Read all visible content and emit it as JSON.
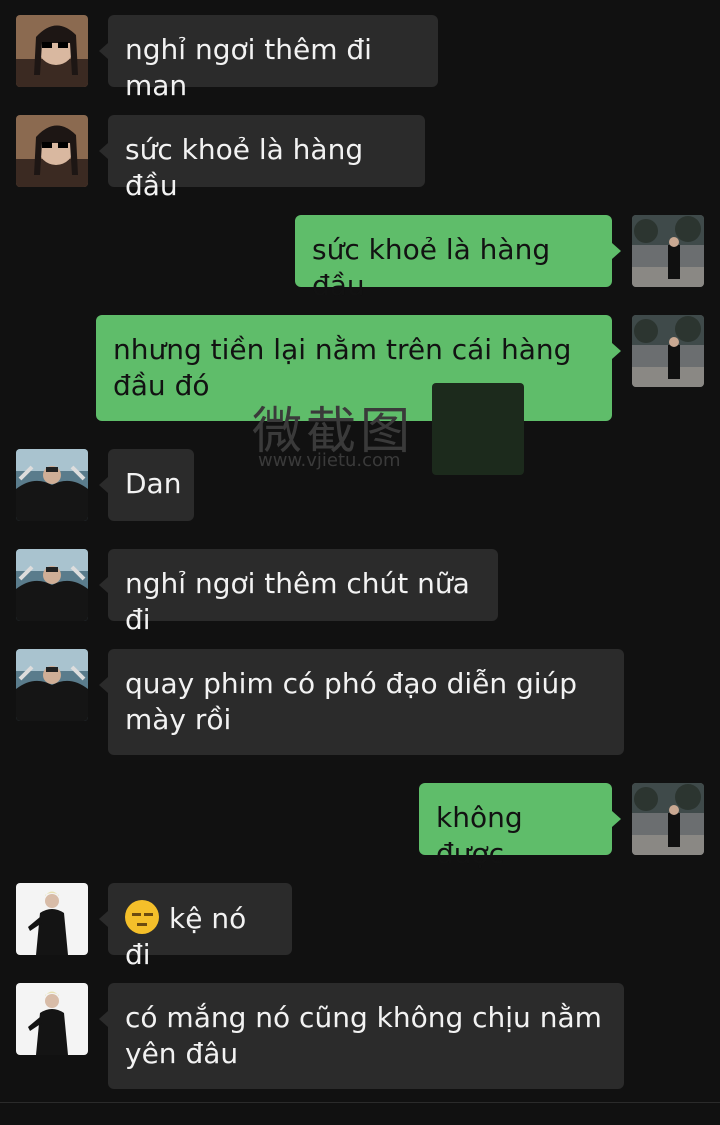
{
  "messages": [
    {
      "side": "in",
      "avatar": "avatar-sunglasses-icon",
      "text": "nghỉ ngơi thêm đi man"
    },
    {
      "side": "in",
      "avatar": "avatar-sunglasses-icon",
      "text": "sức khoẻ là hàng đầu"
    },
    {
      "side": "out",
      "avatar": "avatar-street-icon",
      "text": "sức khoẻ là hàng đầu"
    },
    {
      "side": "out",
      "avatar": "avatar-street-icon",
      "text": "nhưng tiền lại nằm trên cái hàng đầu đó"
    },
    {
      "side": "in",
      "avatar": "avatar-group-icon",
      "text": "Dan"
    },
    {
      "side": "in",
      "avatar": "avatar-group-icon",
      "text": "nghỉ ngơi thêm chút nữa đi"
    },
    {
      "side": "in",
      "avatar": "avatar-group-icon",
      "text": "quay phim có phó đạo diễn giúp mày rồi"
    },
    {
      "side": "out",
      "avatar": "avatar-street-icon",
      "text": "không được"
    },
    {
      "side": "in",
      "avatar": "avatar-suit-icon",
      "emoji": "sweat-smile-emoji",
      "text": "kệ nó đi"
    },
    {
      "side": "in",
      "avatar": "avatar-suit-icon",
      "text": "có mắng nó cũng không chịu nằm yên đâu"
    }
  ],
  "watermark": {
    "title": "微截图",
    "url": "www.vjietu.com"
  },
  "colors": {
    "background": "#111111",
    "incoming": "#2b2b2b",
    "outgoing": "#5fbd6a"
  }
}
